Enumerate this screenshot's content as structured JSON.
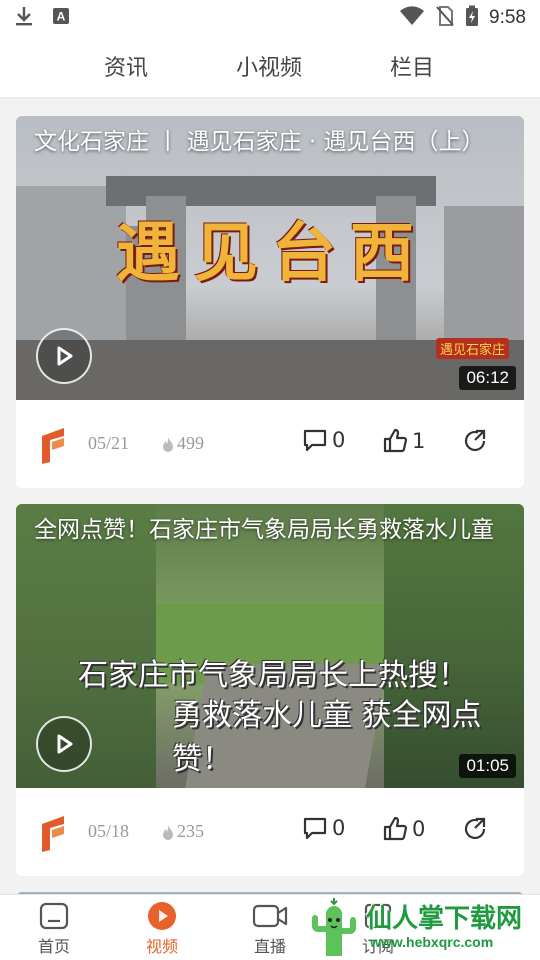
{
  "status_bar": {
    "time": "9:58",
    "left_icons": [
      "download-icon",
      "a-badge-icon"
    ],
    "right_icons": [
      "wifi-icon",
      "no-sim-icon",
      "battery-charging-icon"
    ]
  },
  "top_tabs": [
    "资讯",
    "小视频",
    "栏目"
  ],
  "videos": [
    {
      "title": "文化石家庄 丨 遇见石家庄 · 遇见台西（上）",
      "overlay_text": "遇见台西",
      "badge_text": "遇见石家庄",
      "duration": "06:12",
      "date": "05/21",
      "views": "499",
      "comments": "0",
      "likes": "1"
    },
    {
      "title": "全网点赞！石家庄市气象局局长勇救落水儿童",
      "overlay_line1": "石家庄市气象局局长上热搜！",
      "overlay_line2": "勇救落水儿童 获全网点赞！",
      "duration": "01:05",
      "date": "05/18",
      "views": "235",
      "comments": "0",
      "likes": "0"
    }
  ],
  "bottom_nav": [
    {
      "label": "首页",
      "icon": "home-icon",
      "active": false
    },
    {
      "label": "视频",
      "icon": "video-play-icon",
      "active": true
    },
    {
      "label": "直播",
      "icon": "camera-icon",
      "active": false
    },
    {
      "label": "订阅",
      "icon": "subscribe-icon",
      "active": false
    }
  ],
  "watermark": {
    "title": "仙人掌下载网",
    "url": "www.hebxqrc.com"
  },
  "colors": {
    "accent": "#e9612a",
    "logo": "#e35a2b"
  }
}
